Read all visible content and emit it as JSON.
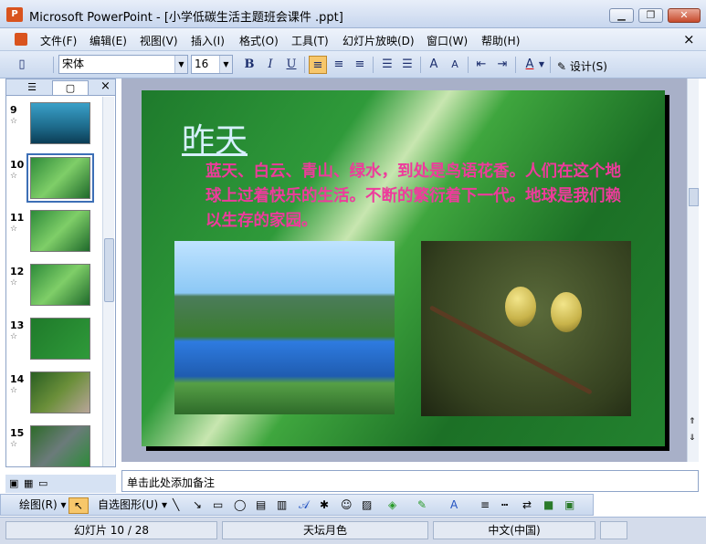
{
  "window": {
    "app_icon": "P",
    "title": "Microsoft PowerPoint - [小学低碳生活主题班会课件 .ppt]",
    "buttons": {
      "minimize": "▁",
      "restore": "❐",
      "close": "✕"
    }
  },
  "menu": {
    "items": [
      "文件(F)",
      "编辑(E)",
      "视图(V)",
      "插入(I)",
      "格式(O)",
      "工具(T)",
      "幻灯片放映(D)",
      "窗口(W)",
      "帮助(H)"
    ],
    "close_doc": "×"
  },
  "toolbar": {
    "font_name": "宋体",
    "font_size": "16",
    "bold": "B",
    "italic": "I",
    "underline": "U",
    "font_color_label": "A",
    "design_label": "设计(S)"
  },
  "slides_panel": {
    "tabs": [
      "outline-icon",
      "slides-icon"
    ],
    "close": "×",
    "thumbnails": [
      {
        "num": "9",
        "selected": false
      },
      {
        "num": "10",
        "selected": true
      },
      {
        "num": "11",
        "selected": false
      },
      {
        "num": "12",
        "selected": false
      },
      {
        "num": "13",
        "selected": false
      },
      {
        "num": "14",
        "selected": false
      },
      {
        "num": "15",
        "selected": false
      }
    ],
    "star": "☆"
  },
  "slide": {
    "title": "昨天",
    "body": "蓝天、白云、青山、绿水，到处是鸟语花香。人们在这个地球上过着快乐的生活。不断的繁衍着下一代。地球是我们赖以生存的家园。"
  },
  "notes": {
    "placeholder": "单击此处添加备注"
  },
  "drawing_toolbar": {
    "draw_label": "绘图(R)",
    "autoshapes_label": "自选图形(U)"
  },
  "status": {
    "slide_indicator": "幻灯片 10 / 28",
    "design_name": "天坛月色",
    "language": "中文(中国)"
  }
}
